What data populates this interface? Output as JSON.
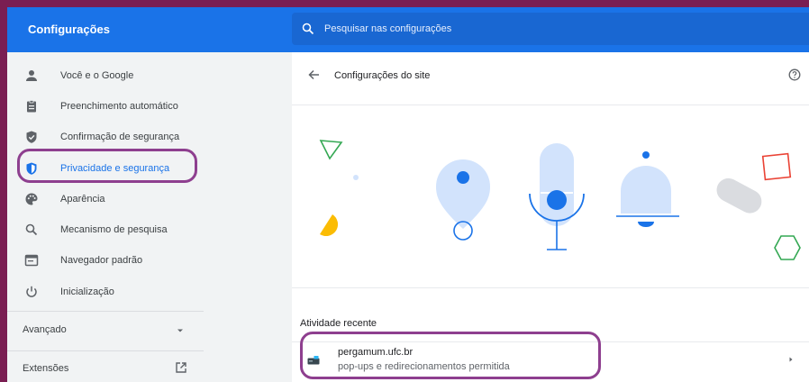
{
  "app": {
    "title": "Configurações"
  },
  "search": {
    "placeholder": "Pesquisar nas configurações"
  },
  "sidebar": {
    "items": [
      {
        "label": "Você e o Google",
        "icon": "person-icon"
      },
      {
        "label": "Preenchimento automático",
        "icon": "clipboard-icon"
      },
      {
        "label": "Confirmação de segurança",
        "icon": "shield-check-icon"
      },
      {
        "label": "Privacidade e segurança",
        "icon": "shield-icon",
        "active": true
      },
      {
        "label": "Aparência",
        "icon": "palette-icon"
      },
      {
        "label": "Mecanismo de pesquisa",
        "icon": "search-icon"
      },
      {
        "label": "Navegador padrão",
        "icon": "browser-icon"
      },
      {
        "label": "Inicialização",
        "icon": "power-icon"
      }
    ],
    "advanced_label": "Avançado",
    "extensions_label": "Extensões"
  },
  "main": {
    "title": "Configurações do site",
    "recent": {
      "title": "Atividade recente",
      "items": [
        {
          "site": "pergamum.ufc.br",
          "description": "pop-ups e redirecionamentos permitida"
        }
      ]
    }
  },
  "colors": {
    "accent": "#1a73e8",
    "highlight": "#8e3f8f",
    "background": "#7a1e52"
  }
}
